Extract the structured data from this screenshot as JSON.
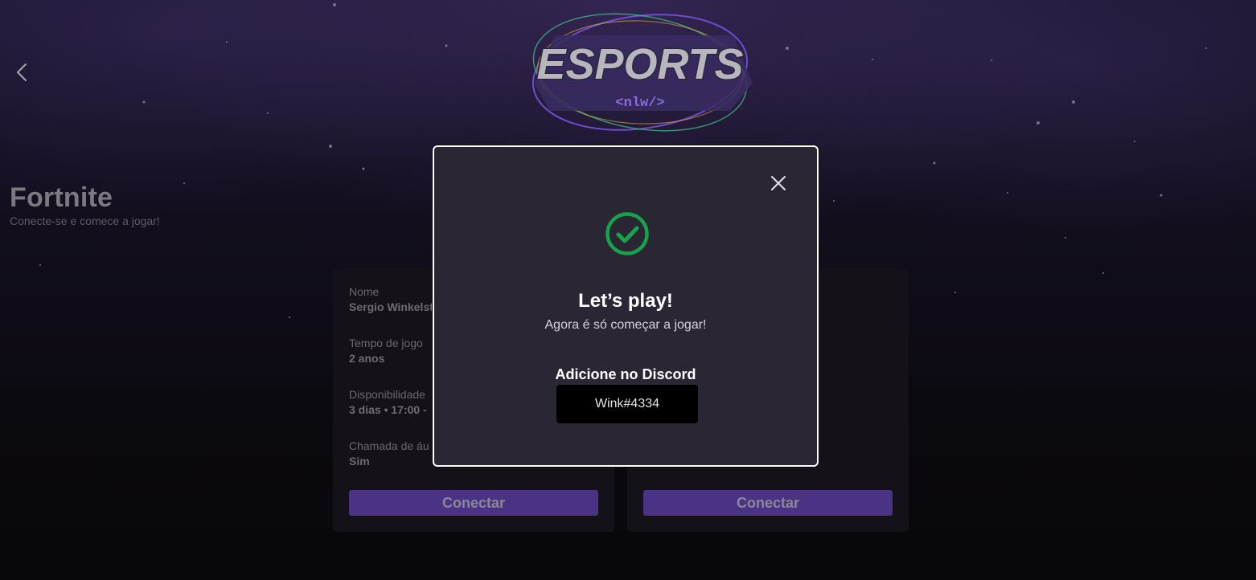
{
  "header": {
    "logo_alt": "ESPORTS <nlw/>",
    "logo_main_text": "ESPORTS",
    "logo_sub_text": "<nlw/>",
    "back_icon": "chevron-left-icon"
  },
  "game": {
    "title": "Fortnite",
    "subtitle": "Conecte-se e comece a jogar!"
  },
  "ads": [
    {
      "fields": [
        {
          "label": "Nome",
          "value": "Sergio Winkelst"
        },
        {
          "label": "Tempo de jogo",
          "value": "2 anos"
        },
        {
          "label": "Disponibilidade",
          "value": "3 dias • 17:00 -"
        },
        {
          "label": "Chamada de áu",
          "value": "Sim"
        }
      ],
      "connect_label": "Conectar"
    },
    {
      "connect_label": "Conectar"
    }
  ],
  "modal": {
    "close_icon": "close-icon",
    "status_icon": "check-circle-icon",
    "title": "Let’s play!",
    "subtitle": "Agora é só começar a jogar!",
    "discord_label": "Adicione no Discord",
    "discord_value": "Wink#4334"
  },
  "colors": {
    "brand_purple": "#8B5CF6",
    "connect_button": "#4a3384",
    "success_green": "#16a34a",
    "modal_bg": "#2a2634"
  }
}
